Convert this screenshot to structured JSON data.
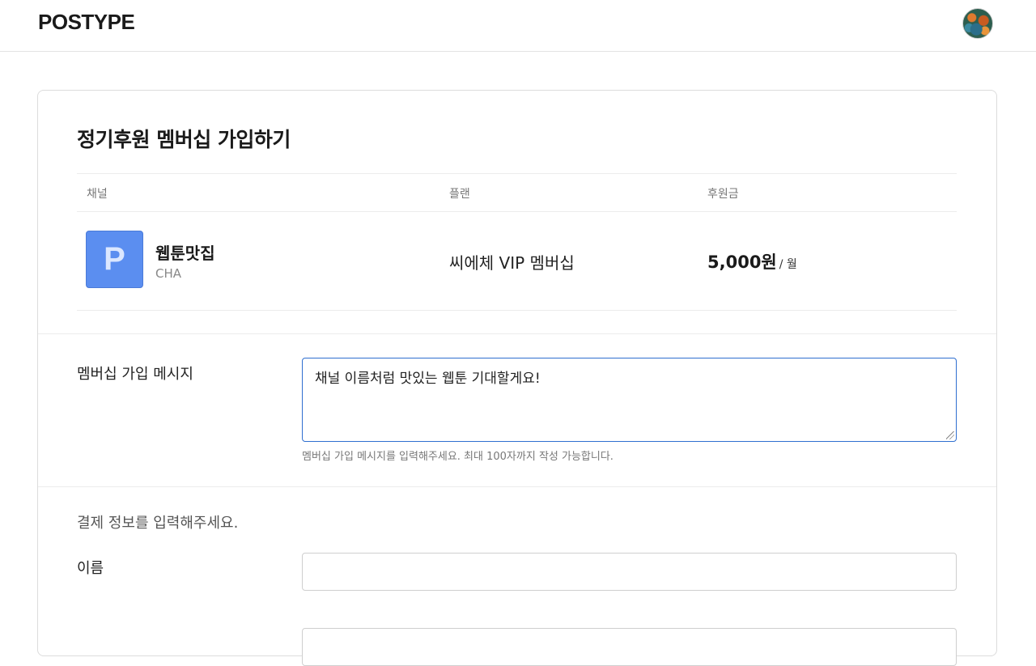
{
  "header": {
    "logo": "POSTYPE",
    "avatar_icon": "user-avatar"
  },
  "page": {
    "title": "정기후원 멤버십 가입하기"
  },
  "table": {
    "columns": [
      "채널",
      "플랜",
      "후원금"
    ],
    "row": {
      "channel_thumb_letter": "P",
      "channel_name": "웹툰맛집",
      "channel_sub": "CHA",
      "plan": "씨에체 VIP 멤버십",
      "amount": "5,000원",
      "amount_unit": "/ 월"
    }
  },
  "message": {
    "label": "멤버십 가입 메시지",
    "value": "채널 이름처럼 맛있는 웹툰 기대할게요!",
    "help": "멤버십 가입 메시지를 입력해주세요. 최대 100자까지 작성 가능합니다."
  },
  "payment": {
    "intro": "결제 정보를 입력해주세요.",
    "name_label": "이름",
    "name_value": ""
  },
  "colors": {
    "accent": "#2f6fd0",
    "channel_thumb": "#5b8ef0"
  }
}
